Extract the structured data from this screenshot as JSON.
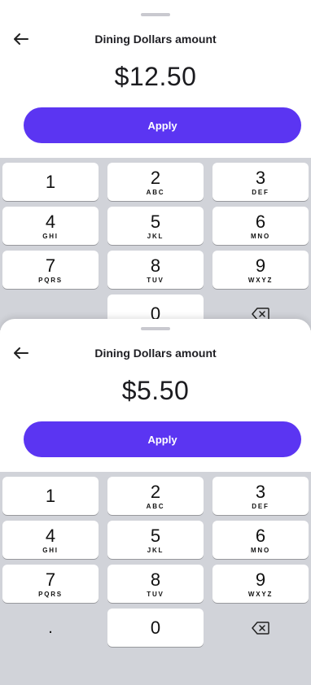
{
  "back_sheet": {
    "title": "Dining Dollars amount",
    "amount": "$12.50",
    "apply_label": "Apply"
  },
  "front_sheet": {
    "title": "Dining Dollars amount",
    "amount": "$5.50",
    "apply_label": "Apply"
  },
  "keypad": {
    "k1": {
      "digit": "1",
      "letters": ""
    },
    "k2": {
      "digit": "2",
      "letters": "ABC"
    },
    "k3": {
      "digit": "3",
      "letters": "DEF"
    },
    "k4": {
      "digit": "4",
      "letters": "GHI"
    },
    "k5": {
      "digit": "5",
      "letters": "JKL"
    },
    "k6": {
      "digit": "6",
      "letters": "MNO"
    },
    "k7": {
      "digit": "7",
      "letters": "PQRS"
    },
    "k8": {
      "digit": "8",
      "letters": "TUV"
    },
    "k9": {
      "digit": "9",
      "letters": "WXYZ"
    },
    "dot": ".",
    "k0": {
      "digit": "0"
    }
  },
  "icons": {
    "back": "arrow-left-icon",
    "delete": "backspace-icon",
    "grabber": "sheet-grabber"
  },
  "colors": {
    "accent": "#5b35f2",
    "keypad_bg": "#d1d3d9",
    "peek": "#a10f2d"
  }
}
